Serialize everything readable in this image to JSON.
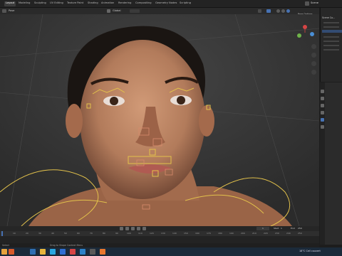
{
  "workspaces": [
    "Layout",
    "Modeling",
    "Sculpting",
    "UV Editing",
    "Texture Paint",
    "Shading",
    "Animation",
    "Rendering",
    "Compositing",
    "Geometry Nodes",
    "Scripting"
  ],
  "viewport": {
    "mode": "Pose",
    "orientation": "Global",
    "options_label": "Pose Options"
  },
  "outliner": {
    "title": "Scene",
    "root": "Scene Co..."
  },
  "timeline": {
    "frames": [
      "10",
      "20",
      "30",
      "40",
      "50",
      "60",
      "70",
      "80",
      "90",
      "100",
      "110",
      "120",
      "130",
      "140",
      "150",
      "160",
      "170",
      "180",
      "190",
      "200",
      "210",
      "220",
      "230",
      "240",
      "250"
    ],
    "current_frame": "1",
    "start_label": "Start",
    "start": "1",
    "end_label": "End",
    "end": "250"
  },
  "status": {
    "left": "Select",
    "mid": "Drag to Shape Context Menu"
  },
  "taskbar": {
    "weather": "18°C  Cell couvert",
    "icons": [
      "start-icon",
      "search-icon",
      "task-view-icon",
      "file-explorer-icon",
      "edge-icon",
      "mail-icon",
      "chrome-icon",
      "vscode-icon",
      "photos-icon",
      "blender-icon"
    ]
  },
  "colors": {
    "accent": "#4772b3",
    "bone": "#e2c14b",
    "skin": "#b98463"
  }
}
